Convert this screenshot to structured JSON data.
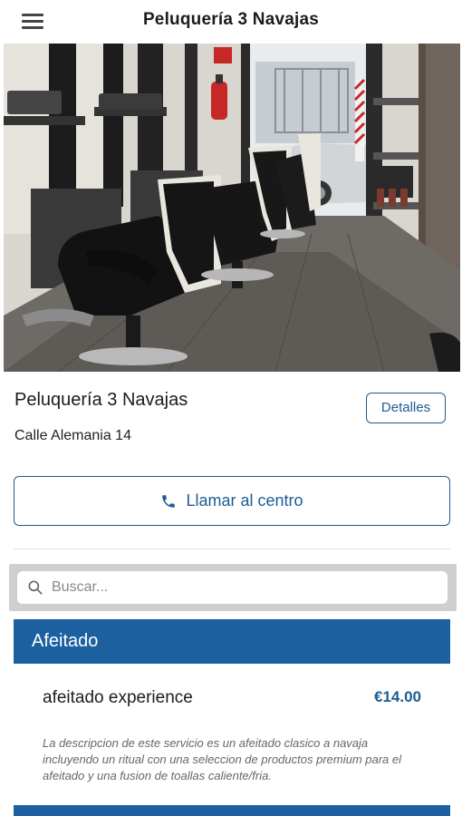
{
  "appbar": {
    "title": "Peluquería 3 Navajas",
    "menu_icon": "hamburger-menu-icon"
  },
  "store": {
    "name": "Peluquería 3 Navajas",
    "address": "Calle Alemania 14",
    "details_label": "Detalles",
    "call_label": "Llamar al centro",
    "call_icon": "phone-icon"
  },
  "search": {
    "placeholder": "Buscar...",
    "value": "",
    "icon": "search-icon"
  },
  "categories": [
    {
      "title": "Afeitado",
      "services": [
        {
          "name": "afeitado experience",
          "price": "€14.00",
          "description": "La descripcion de este servicio es un afeitado clasico a navaja incluyendo un ritual con una seleccion de productos premium para el afeitado y una fusion de toallas caliente/fria."
        }
      ]
    }
  ],
  "colors": {
    "accent": "#1d5c93",
    "category_bg": "#1c60a0",
    "search_bar_bg": "#cfcfcf"
  }
}
